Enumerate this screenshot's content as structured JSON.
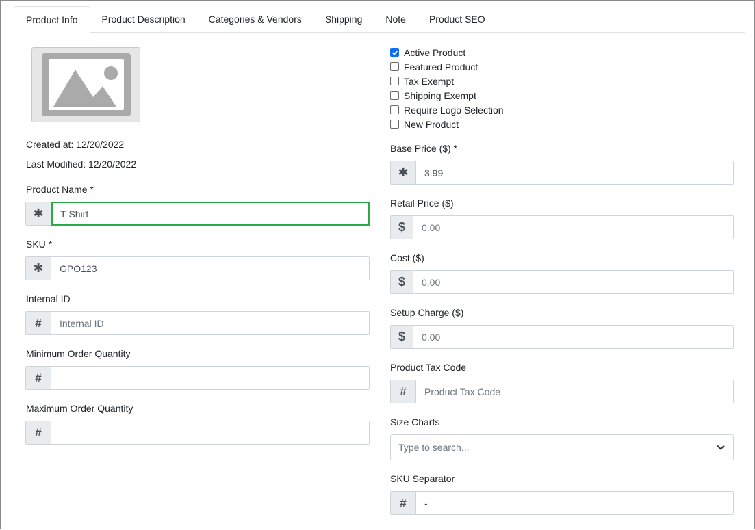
{
  "tabs": [
    {
      "label": "Product Info",
      "active": true
    },
    {
      "label": "Product Description"
    },
    {
      "label": "Categories & Vendors"
    },
    {
      "label": "Shipping"
    },
    {
      "label": "Note"
    },
    {
      "label": "Product SEO"
    }
  ],
  "meta": {
    "created": "Created at: 12/20/2022",
    "modified": "Last Modified: 12/20/2022"
  },
  "left": {
    "product_name": {
      "label": "Product Name *",
      "value": "T-Shirt",
      "icon": "asterisk-icon"
    },
    "sku": {
      "label": "SKU *",
      "value": "GPO123",
      "icon": "asterisk-icon"
    },
    "internal_id": {
      "label": "Internal ID",
      "value": "",
      "placeholder": "Internal ID",
      "icon": "hash-icon"
    },
    "min_qty": {
      "label": "Minimum Order Quantity",
      "value": "",
      "icon": "hash-icon"
    },
    "max_qty": {
      "label": "Maximum Order Quantity",
      "value": "",
      "icon": "hash-icon"
    }
  },
  "checkboxes": [
    {
      "label": "Active Product",
      "checked": true
    },
    {
      "label": "Featured Product",
      "checked": false
    },
    {
      "label": "Tax Exempt",
      "checked": false
    },
    {
      "label": "Shipping Exempt",
      "checked": false
    },
    {
      "label": "Require Logo Selection",
      "checked": false
    },
    {
      "label": "New Product",
      "checked": false
    }
  ],
  "right": {
    "base_price": {
      "label": "Base Price ($) *",
      "value": "3.99",
      "icon": "asterisk-icon"
    },
    "retail_price": {
      "label": "Retail Price ($)",
      "value": "",
      "placeholder": "0.00",
      "icon": "dollar-icon"
    },
    "cost": {
      "label": "Cost ($)",
      "value": "",
      "placeholder": "0.00",
      "icon": "dollar-icon"
    },
    "setup_charge": {
      "label": "Setup Charge ($)",
      "value": "",
      "placeholder": "0.00",
      "icon": "dollar-icon"
    },
    "tax_code": {
      "label": "Product Tax Code",
      "value": "",
      "placeholder": "Product Tax Code",
      "icon": "hash-icon"
    },
    "size_charts": {
      "label": "Size Charts",
      "placeholder": "Type to search..."
    },
    "sku_separator": {
      "label": "SKU Separator",
      "value": "-",
      "icon": "hash-icon"
    }
  },
  "colors": {
    "accent": "#0d6efd",
    "focus": "#28a745"
  }
}
